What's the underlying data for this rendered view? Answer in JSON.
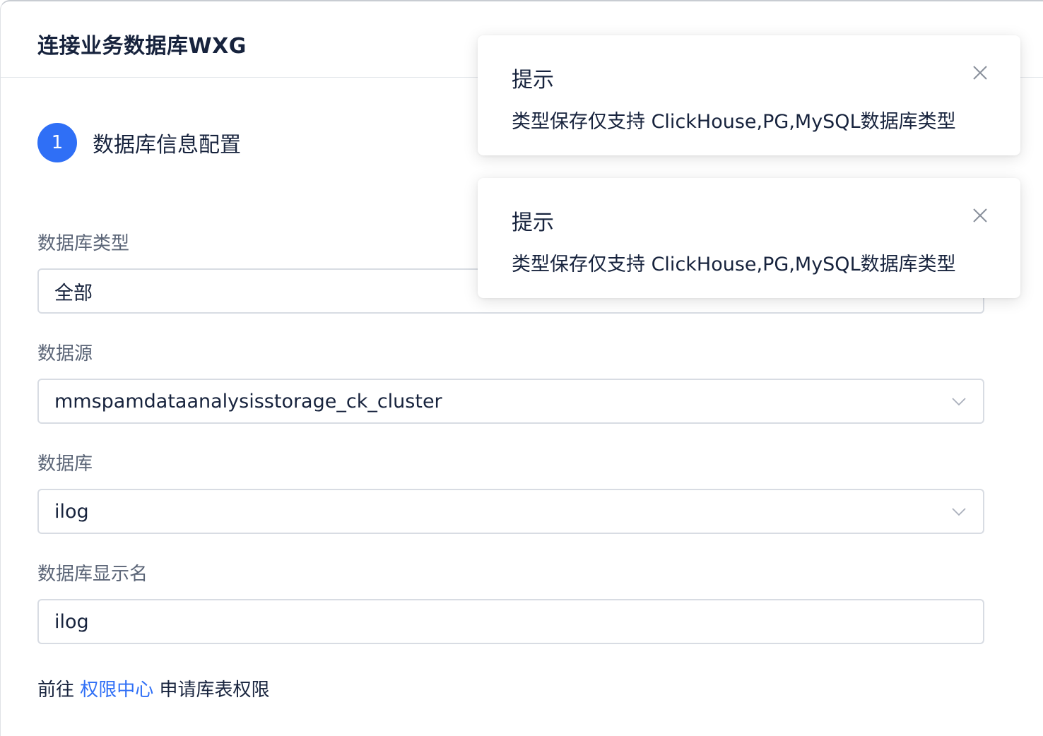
{
  "dialog": {
    "title": "连接业务数据库WXG"
  },
  "step": {
    "number": "1",
    "title": "数据库信息配置"
  },
  "fields": {
    "db_type": {
      "label": "数据库类型",
      "value": "全部"
    },
    "datasource": {
      "label": "数据源",
      "value": "mmspamdataanalysisstorage_ck_cluster"
    },
    "database": {
      "label": "数据库",
      "value": "ilog"
    },
    "display_name": {
      "label": "数据库显示名",
      "value": "ilog"
    }
  },
  "footer": {
    "prefix": "前往 ",
    "link": "权限中心",
    "suffix": " 申请库表权限"
  },
  "toasts": [
    {
      "title": "提示",
      "message": "类型保存仅支持 ClickHouse,PG,MySQL数据库类型"
    },
    {
      "title": "提示",
      "message": "类型保存仅支持 ClickHouse,PG,MySQL数据库类型"
    }
  ],
  "colors": {
    "accent": "#2f6ff6",
    "text_primary": "#17233d",
    "text_label": "#5b6577",
    "border": "#d8dce3"
  },
  "icons": {
    "toast_close": "close-icon",
    "select_arrow": "chevron-down-icon"
  }
}
